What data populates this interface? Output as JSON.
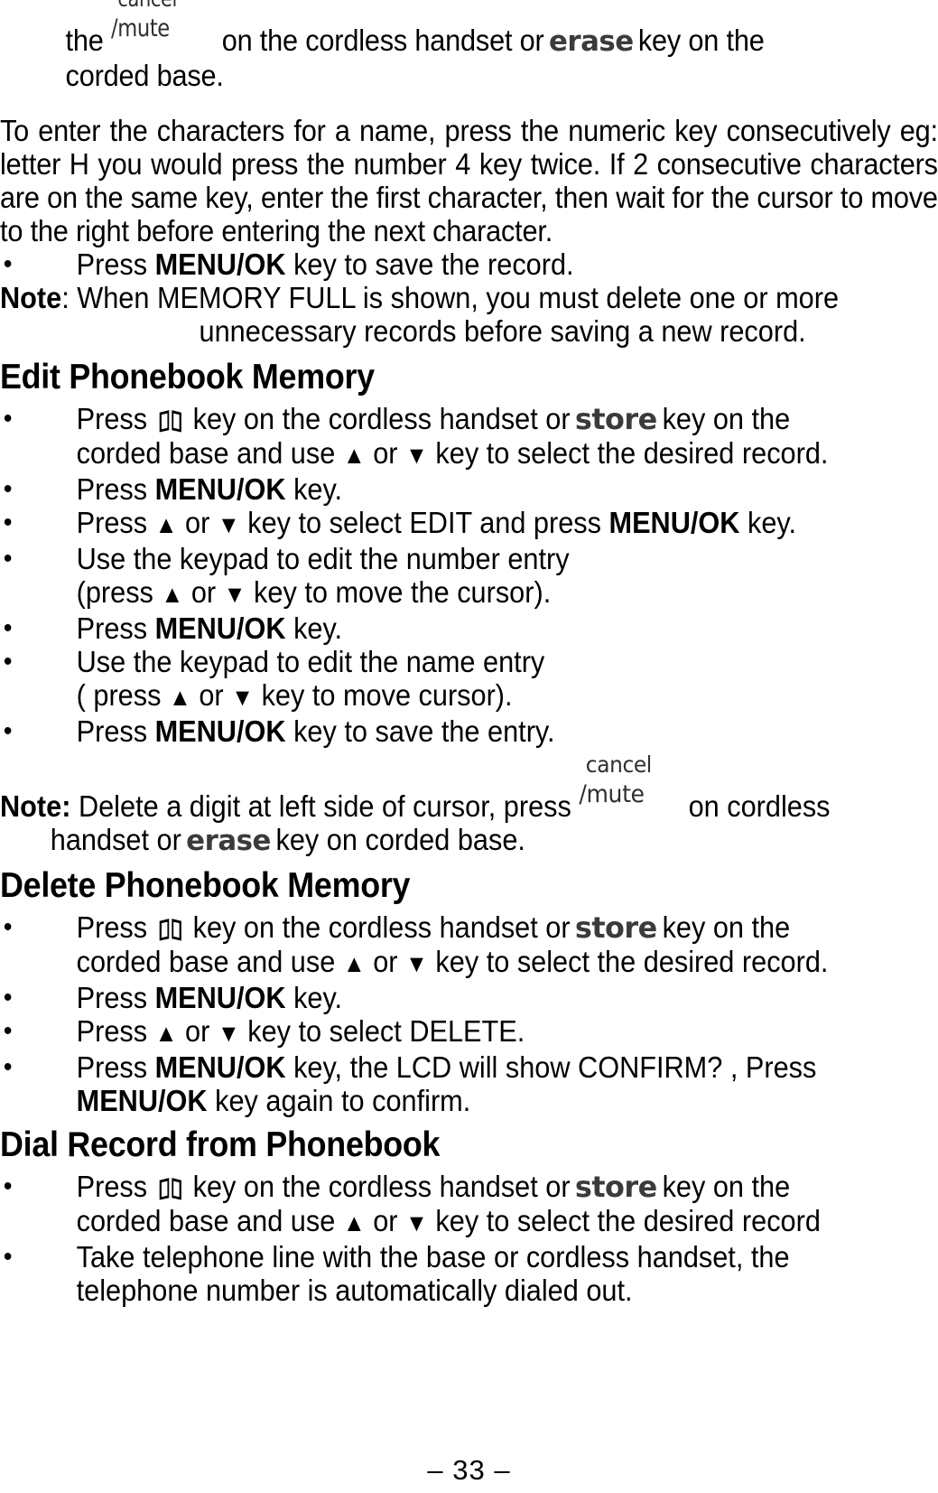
{
  "document": {
    "page_number": "– 33 –",
    "icons": {
      "phonebook": "open-book-icon",
      "bullet": "•",
      "up_arrow": "▲",
      "down_arrow": "▼"
    },
    "key_labels": {
      "cancel_top": "cancel",
      "mute_bottom": "/mute",
      "erase": "erase",
      "store": "store",
      "menu_ok": "MENU/OK"
    },
    "colors": {
      "text": "#000000",
      "key_label": "#3b3b3b",
      "background": "#ffffff"
    }
  },
  "intro": {
    "line1_pre": "the",
    "line1_mid": "on the cordless handset or",
    "line1_post": "key on the",
    "line2": "corded base."
  },
  "paragraph1": {
    "text": "To enter the characters for a name, press the numeric key consecutively eg: letter H you would press the number 4 key twice. If 2 consecutive characters are on the same key, enter the first character, then wait for the cursor to move to the right before entering the next character."
  },
  "bullet_save_record": {
    "pre": "Press",
    "key": "MENU/OK",
    "post": "key to save the record."
  },
  "note_memory_full": {
    "label": "Note",
    "colon": ":",
    "line1": "When MEMORY FULL is shown, you must delete one or more",
    "line2": "unnecessary records before saving a new record."
  },
  "sections": [
    {
      "heading": "Edit Phonebook Memory",
      "items": [
        {
          "type": "press-book-store",
          "pre": "Press",
          "mid": "key on the cordless handset or",
          "post": "key on the",
          "cont_pre": "corded base and use",
          "cont_or": "or",
          "cont_post": "key to select the desired record."
        },
        {
          "type": "press-menu",
          "pre": "Press",
          "key": "MENU/OK",
          "post": "key."
        },
        {
          "type": "arrows-select",
          "pre": "Press",
          "or": "or",
          "mid": "key to select EDIT and press",
          "key": "MENU/OK",
          "post": "key."
        },
        {
          "type": "keypad-edit",
          "line1": "Use the keypad to edit the number entry",
          "line2_pre": "(press",
          "line2_or": "or",
          "line2_post": "key to move the cursor)."
        },
        {
          "type": "press-menu",
          "pre": "Press",
          "key": "MENU/OK",
          "post": "key."
        },
        {
          "type": "keypad-edit",
          "line1": "Use the keypad to edit the name entry",
          "line2_pre": "( press",
          "line2_or": "or",
          "line2_post": "key to move cursor)."
        },
        {
          "type": "press-menu",
          "pre": "Press",
          "key": "MENU/OK",
          "post": "key to save the entry."
        }
      ]
    }
  ],
  "note_delete_digit": {
    "label": "Note:",
    "line1_pre": "Delete a digit at left side of cursor, press",
    "line1_post": "on cordless",
    "line2_pre": "handset or",
    "line2_post": "key on corded base."
  },
  "section_delete": {
    "heading": "Delete Phonebook Memory",
    "item1": {
      "pre": "Press",
      "mid": "key on the cordless handset or",
      "post": "key on the",
      "cont_pre": "corded base and use",
      "cont_or": "or",
      "cont_post": "key to select the desired record."
    },
    "item2": {
      "pre": "Press",
      "key": "MENU/OK",
      "post": "key."
    },
    "item3": {
      "pre": "Press",
      "or": "or",
      "post": "key to select DELETE."
    },
    "item4": {
      "pre": "Press",
      "key1": "MENU/OK",
      "mid": "key, the LCD will show CONFIRM? , Press",
      "key2": "MENU/OK",
      "post": "key again to confirm."
    }
  },
  "section_dial": {
    "heading": "Dial Record from Phonebook",
    "item1": {
      "pre": "Press",
      "mid": "key on the cordless handset or",
      "post": "key on the",
      "cont_pre": "corded base and use",
      "cont_or": "or",
      "cont_post": "key to select the desired record"
    },
    "item2": {
      "line1": "Take telephone line with the base or cordless handset, the",
      "line2": "telephone number is automatically dialed out."
    }
  }
}
